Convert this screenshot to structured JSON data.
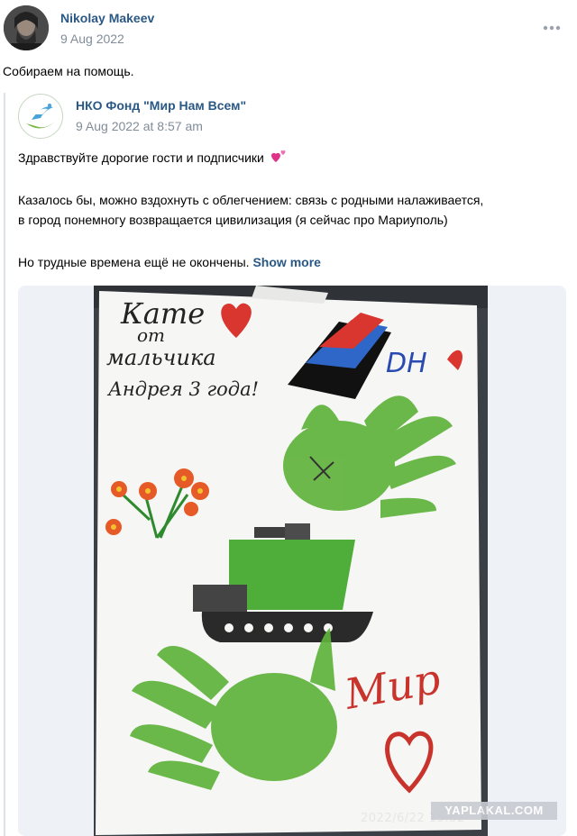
{
  "author": {
    "name": "Nikolay Makeev",
    "date": "9 Aug 2022"
  },
  "post": {
    "text": "Собираем на помощь."
  },
  "repost": {
    "name": "НКО Фонд \"Мир Нам Всем\"",
    "date": "9 Aug 2022 at 8:57 am",
    "greeting": "Здравствуйте дорогие гости и подписчики",
    "para2_line1": "Казалось бы, можно вздохнуть с облегчением: связь с родными налаживается,",
    "para2_line2": "в город понемногу возвращается цивилизация (я сейчас про Мариуполь)",
    "para3": "Но трудные времена ещё не окончены.",
    "show_more": "Show more"
  },
  "photo": {
    "drawing_text": {
      "line1": "Кате",
      "line2": "от",
      "line3": "мальчика",
      "line4": "Андрея 3 года!",
      "dn": "DН",
      "peace": "Мир"
    },
    "timestamp": "2022/6/22 15:52"
  },
  "watermark": "YAPLAKAL.COM",
  "icons": {
    "more": "more-horizontal-icon",
    "heart": "two-hearts-icon"
  },
  "colors": {
    "link": "#2a5885",
    "muted": "#818c99",
    "accent_heart": "#e0318a"
  }
}
